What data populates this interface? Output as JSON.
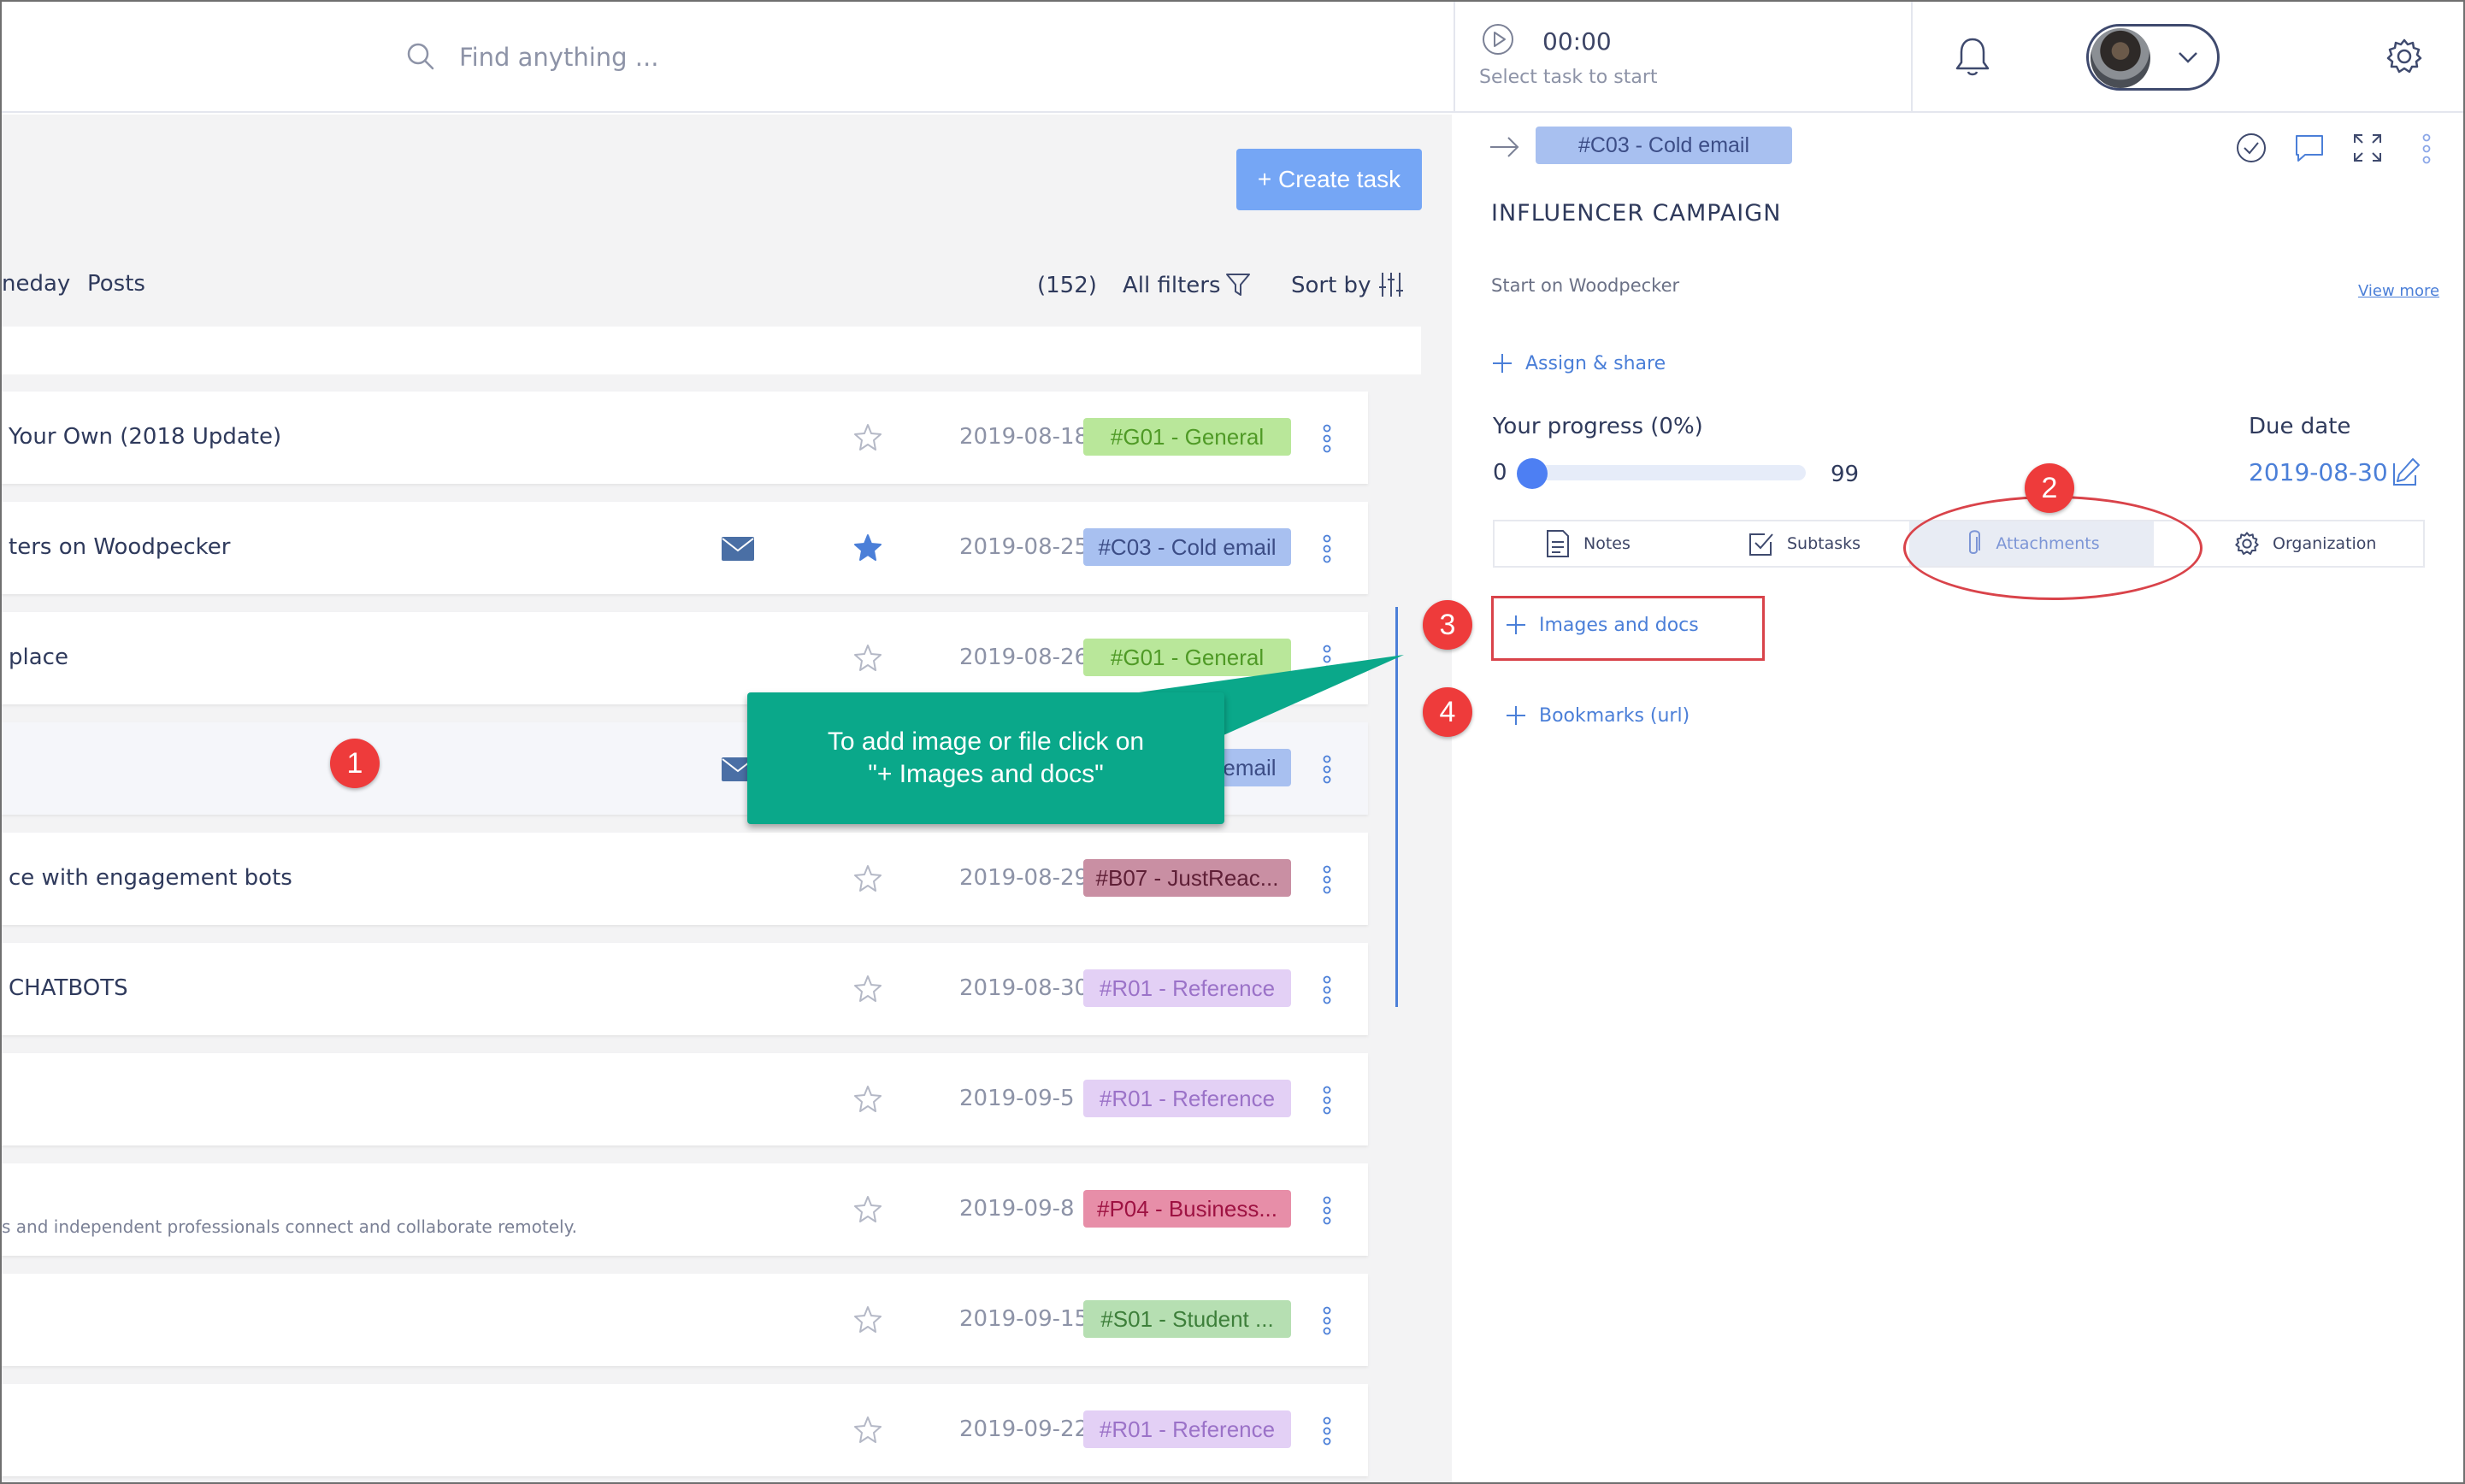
{
  "search": {
    "placeholder": "Find anything ..."
  },
  "timer": {
    "time": "00:00",
    "hint": "Select task to start"
  },
  "toolbar": {
    "create_task": "+ Create task"
  },
  "views": {
    "tab1": "neday",
    "tab2": "Posts"
  },
  "filters": {
    "count": "(152)",
    "all_filters": "All filters",
    "sort_by": "Sort by"
  },
  "tasks": [
    {
      "title": "Your Own (2018 Update)",
      "sub": "",
      "starred": false,
      "mail": false,
      "date": "2019-08-18",
      "tag": "#G01 - General",
      "tag_bg": "#b9e79a",
      "tag_fg": "#4f9a26"
    },
    {
      "title": "ters on Woodpecker",
      "sub": "",
      "starred": true,
      "mail": true,
      "date": "2019-08-25",
      "tag": "#C03 - Cold email",
      "tag_bg": "#a8c0f0",
      "tag_fg": "#3c4d86"
    },
    {
      "title": "place",
      "sub": "",
      "starred": false,
      "mail": false,
      "date": "2019-08-26",
      "tag": "#G01 - General",
      "tag_bg": "#b9e79a",
      "tag_fg": "#4f9a26"
    },
    {
      "title": "",
      "sub": "",
      "starred": false,
      "mail": true,
      "date": "",
      "tag": "#C03 - Cold email",
      "tag_bg": "#a8c0f0",
      "tag_fg": "#3c4d86"
    },
    {
      "title": "ce with engagement bots",
      "sub": "",
      "starred": false,
      "mail": false,
      "date": "2019-08-29",
      "tag": "#B07 - JustReac...",
      "tag_bg": "#c98fa3",
      "tag_fg": "#5e1f36"
    },
    {
      "title": "CHATBOTS",
      "sub": "",
      "starred": false,
      "mail": false,
      "date": "2019-08-30",
      "tag": "#R01 - Reference",
      "tag_bg": "#e3d0f5",
      "tag_fg": "#9b72c8"
    },
    {
      "title": "",
      "sub": "",
      "starred": false,
      "mail": false,
      "date": "2019-09-5",
      "tag": "#R01 - Reference",
      "tag_bg": "#e3d0f5",
      "tag_fg": "#9b72c8"
    },
    {
      "title": "",
      "sub": "s and independent professionals connect and collaborate remotely.",
      "starred": false,
      "mail": false,
      "date": "2019-09-8",
      "tag": "#P04 - Business...",
      "tag_bg": "#e78ea8",
      "tag_fg": "#9e1242"
    },
    {
      "title": "",
      "sub": "",
      "starred": false,
      "mail": false,
      "date": "2019-09-15",
      "tag": "#S01 - Student ...",
      "tag_bg": "#b6dfb2",
      "tag_fg": "#3d7f3a"
    },
    {
      "title": "",
      "sub": "",
      "starred": false,
      "mail": false,
      "date": "2019-09-22",
      "tag": "#R01 - Reference",
      "tag_bg": "#e3d0f5",
      "tag_fg": "#9b72c8"
    }
  ],
  "detail": {
    "tag": "#C03 - Cold email",
    "title": "INFLUENCER CAMPAIGN",
    "start_on": "Start on Woodpecker",
    "view_more": "View more",
    "assign": "Assign & share",
    "progress_label": "Your progress  (0%)",
    "progress_min": "0",
    "progress_max": "99",
    "progress_value": 0,
    "due_label": "Due date",
    "due_value": "2019-08-30",
    "tabs": {
      "notes": "Notes",
      "subtasks": "Subtasks",
      "attachments": "Attachments",
      "organization": "Organization"
    },
    "add_images": "Images and docs",
    "add_bookmarks": "Bookmarks (url)"
  },
  "annotations": {
    "badge1": "1",
    "badge2": "2",
    "badge3": "3",
    "badge4": "4",
    "callout_line1": "To add image or file click on",
    "callout_line2": "\"+ Images and docs\""
  },
  "colors": {
    "accent": "#4b7fd8",
    "button": "#75a6f5",
    "callout": "#0aa88a",
    "annotation": "#ee3b3b"
  }
}
